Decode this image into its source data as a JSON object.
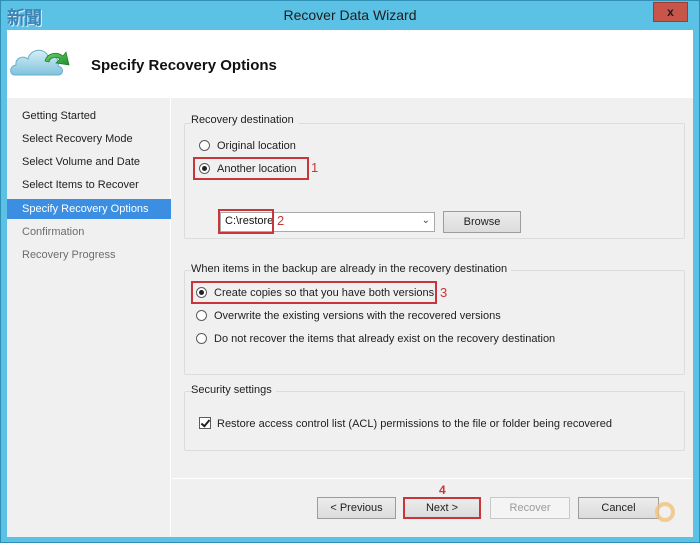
{
  "window": {
    "title": "Recover Data Wizard",
    "close_label": "x",
    "watermark_logo": "新聞"
  },
  "header": {
    "icon": "cloud-restore-icon",
    "title": "Specify Recovery Options"
  },
  "nav": {
    "items": [
      {
        "label": "Getting Started",
        "state": "done"
      },
      {
        "label": "Select Recovery Mode",
        "state": "done"
      },
      {
        "label": "Select Volume and Date",
        "state": "done"
      },
      {
        "label": "Select Items to Recover",
        "state": "done"
      },
      {
        "label": "Specify Recovery Options",
        "state": "active"
      },
      {
        "label": "Confirmation",
        "state": "pending"
      },
      {
        "label": "Recovery Progress",
        "state": "pending"
      }
    ]
  },
  "destination": {
    "group_label": "Recovery destination",
    "options": [
      {
        "label": "Original location",
        "checked": false
      },
      {
        "label": "Another location",
        "checked": true
      }
    ],
    "path_value": "C:\\restore",
    "browse_label": "Browse"
  },
  "conflict": {
    "group_label": "When items in the backup are already in the recovery destination",
    "options": [
      {
        "label": "Create copies so that you have both versions",
        "checked": true
      },
      {
        "label": "Overwrite the existing versions with the recovered versions",
        "checked": false
      },
      {
        "label": "Do not recover the items that already exist on the recovery destination",
        "checked": false
      }
    ]
  },
  "security": {
    "group_label": "Security settings",
    "acl_label": "Restore access control list (ACL) permissions to the file or folder being recovered",
    "acl_checked": true
  },
  "annotations": {
    "n1": "1",
    "n2": "2",
    "n3": "3",
    "n4": "4",
    "color": "#c8363c"
  },
  "footer": {
    "previous_label": "< Previous",
    "next_label": "Next >",
    "recover_label": "Recover",
    "cancel_label": "Cancel"
  },
  "colors": {
    "title_bar": "#5cc2e5",
    "nav_active": "#3b8ee2",
    "close_button": "#c8554a"
  }
}
